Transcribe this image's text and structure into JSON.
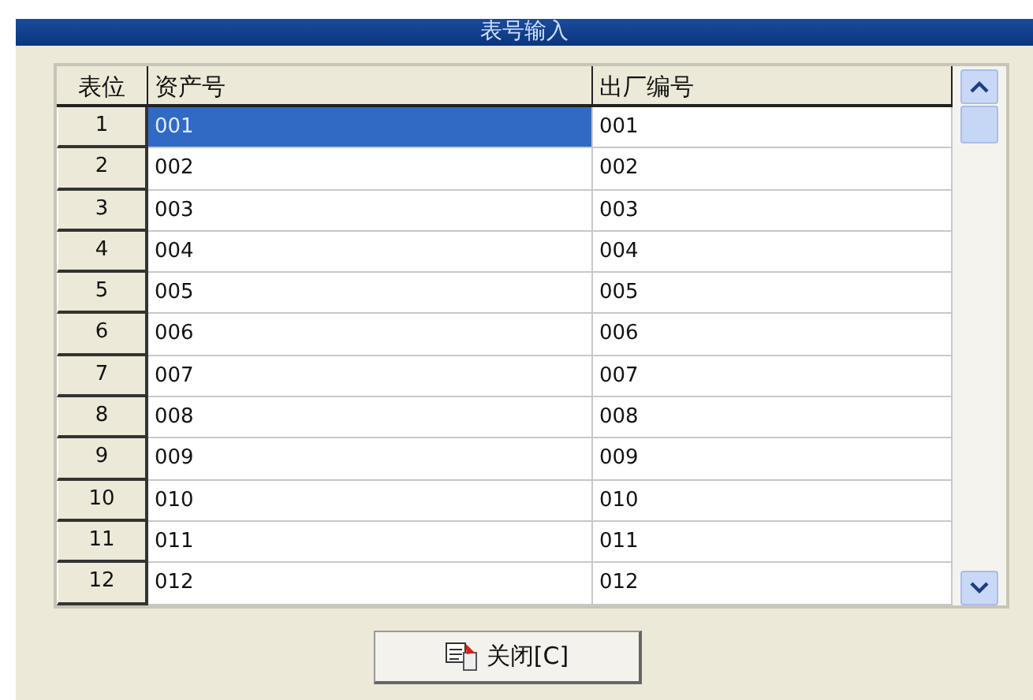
{
  "window": {
    "title": "表号输入"
  },
  "table": {
    "columns": [
      "表位",
      "资产号",
      "出厂编号"
    ],
    "rows": [
      {
        "cells": [
          "1",
          "001",
          "001"
        ],
        "selected": true
      },
      {
        "cells": [
          "2",
          "002",
          "002"
        ],
        "selected": false
      },
      {
        "cells": [
          "3",
          "003",
          "003"
        ],
        "selected": false
      },
      {
        "cells": [
          "4",
          "004",
          "004"
        ],
        "selected": false
      },
      {
        "cells": [
          "5",
          "005",
          "005"
        ],
        "selected": false
      },
      {
        "cells": [
          "6",
          "006",
          "006"
        ],
        "selected": false
      },
      {
        "cells": [
          "7",
          "007",
          "007"
        ],
        "selected": false
      },
      {
        "cells": [
          "8",
          "008",
          "008"
        ],
        "selected": false
      },
      {
        "cells": [
          "9",
          "009",
          "009"
        ],
        "selected": false
      },
      {
        "cells": [
          "10",
          "010",
          "010"
        ],
        "selected": false
      },
      {
        "cells": [
          "11",
          "011",
          "011"
        ],
        "selected": false
      },
      {
        "cells": [
          "12",
          "012",
          "012"
        ],
        "selected": false
      }
    ]
  },
  "buttons": [
    {
      "label": "关闭[C]"
    }
  ]
}
